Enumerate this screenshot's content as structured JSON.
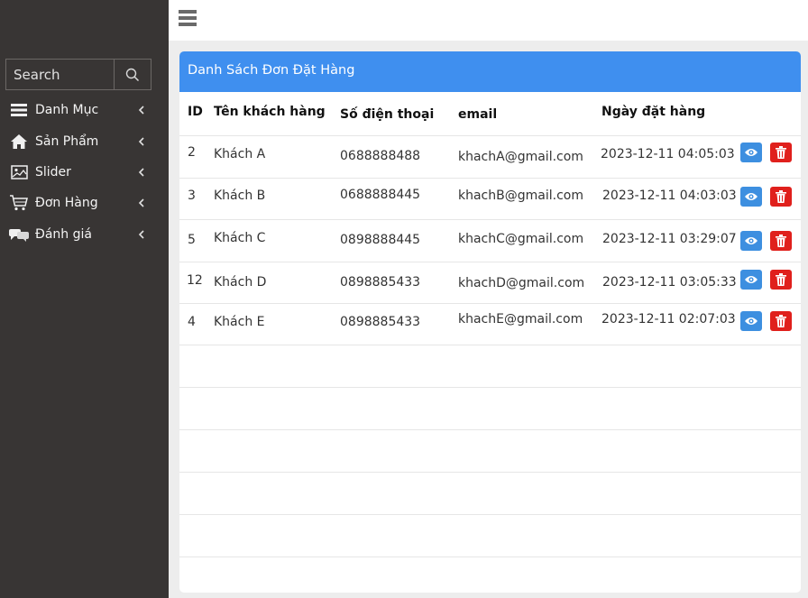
{
  "sidebar": {
    "search": {
      "placeholder": "Search"
    },
    "items": [
      {
        "label": "Danh Mục",
        "icon": "list-icon"
      },
      {
        "label": "Sản Phẩm",
        "icon": "home-icon"
      },
      {
        "label": "Slider",
        "icon": "image-icon"
      },
      {
        "label": "Đơn Hàng",
        "icon": "cart-icon"
      },
      {
        "label": "Đánh giá",
        "icon": "comments-icon"
      }
    ]
  },
  "card": {
    "title": "Danh Sách Đơn Đặt Hàng",
    "columns": [
      "ID",
      "Tên khách hàng",
      "Số điện thoại",
      "email",
      "Ngày đặt hàng"
    ],
    "rows": [
      {
        "id": "2",
        "name": "Khách A",
        "phone": "0688888488",
        "email": "khachA@gmail.com",
        "date": "2023-12-11 04:05:03"
      },
      {
        "id": "3",
        "name": "Khách B",
        "phone": "0688888445",
        "email": "khachB@gmail.com",
        "date": "2023-12-11 04:03:03"
      },
      {
        "id": "5",
        "name": "Khách C",
        "phone": "0898888445",
        "email": "khachC@gmail.com",
        "date": "2023-12-11 03:29:07"
      },
      {
        "id": "12",
        "name": "Khách D",
        "phone": "0898885433",
        "email": "khachD@gmail.com",
        "date": "2023-12-11 03:05:33"
      },
      {
        "id": "4",
        "name": "Khách E",
        "phone": "0898885433",
        "email": "khachE@gmail.com",
        "date": "2023-12-11 02:07:03"
      }
    ]
  },
  "colors": {
    "sidebar": "#383534",
    "header": "#3f8fef",
    "view": "#3d8fe0",
    "delete": "#e0201c"
  }
}
